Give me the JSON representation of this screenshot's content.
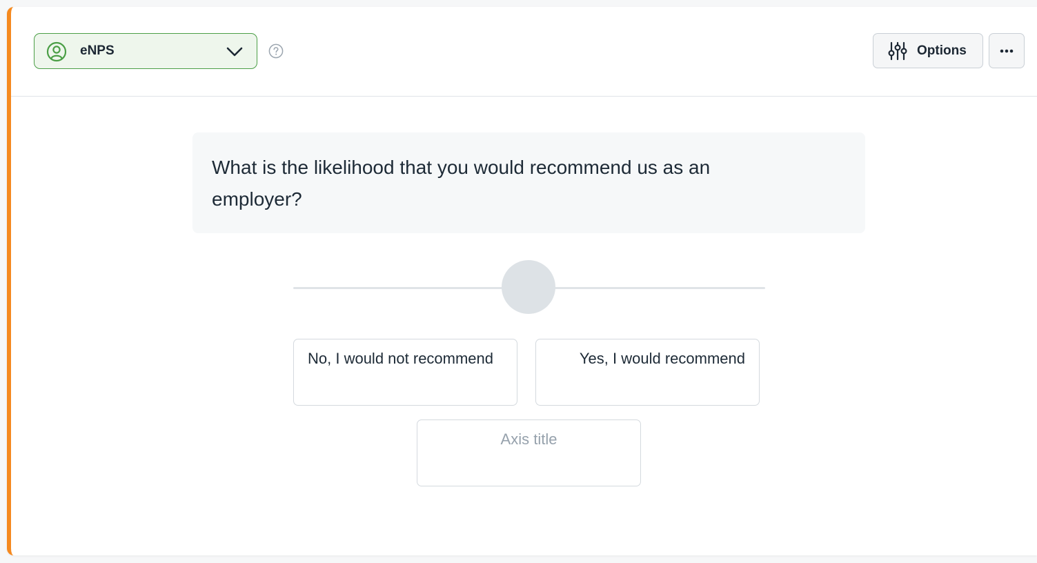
{
  "header": {
    "question_type": {
      "label": "eNPS",
      "icon": "person-circle-icon"
    },
    "help_icon": "question-circle-icon",
    "options_label": "Options",
    "more_icon": "more-dots-icon"
  },
  "question": {
    "text": "What is the likelihood that you would recommend us as an employer?"
  },
  "scale": {
    "low_label": "No, I would not recommend",
    "high_label": "Yes, I would recommend",
    "axis_title_placeholder": "Axis title"
  },
  "colors": {
    "accent_bar": "#f5891f",
    "type_select_border": "#4a9e45",
    "type_select_bg": "#eef6ec"
  }
}
